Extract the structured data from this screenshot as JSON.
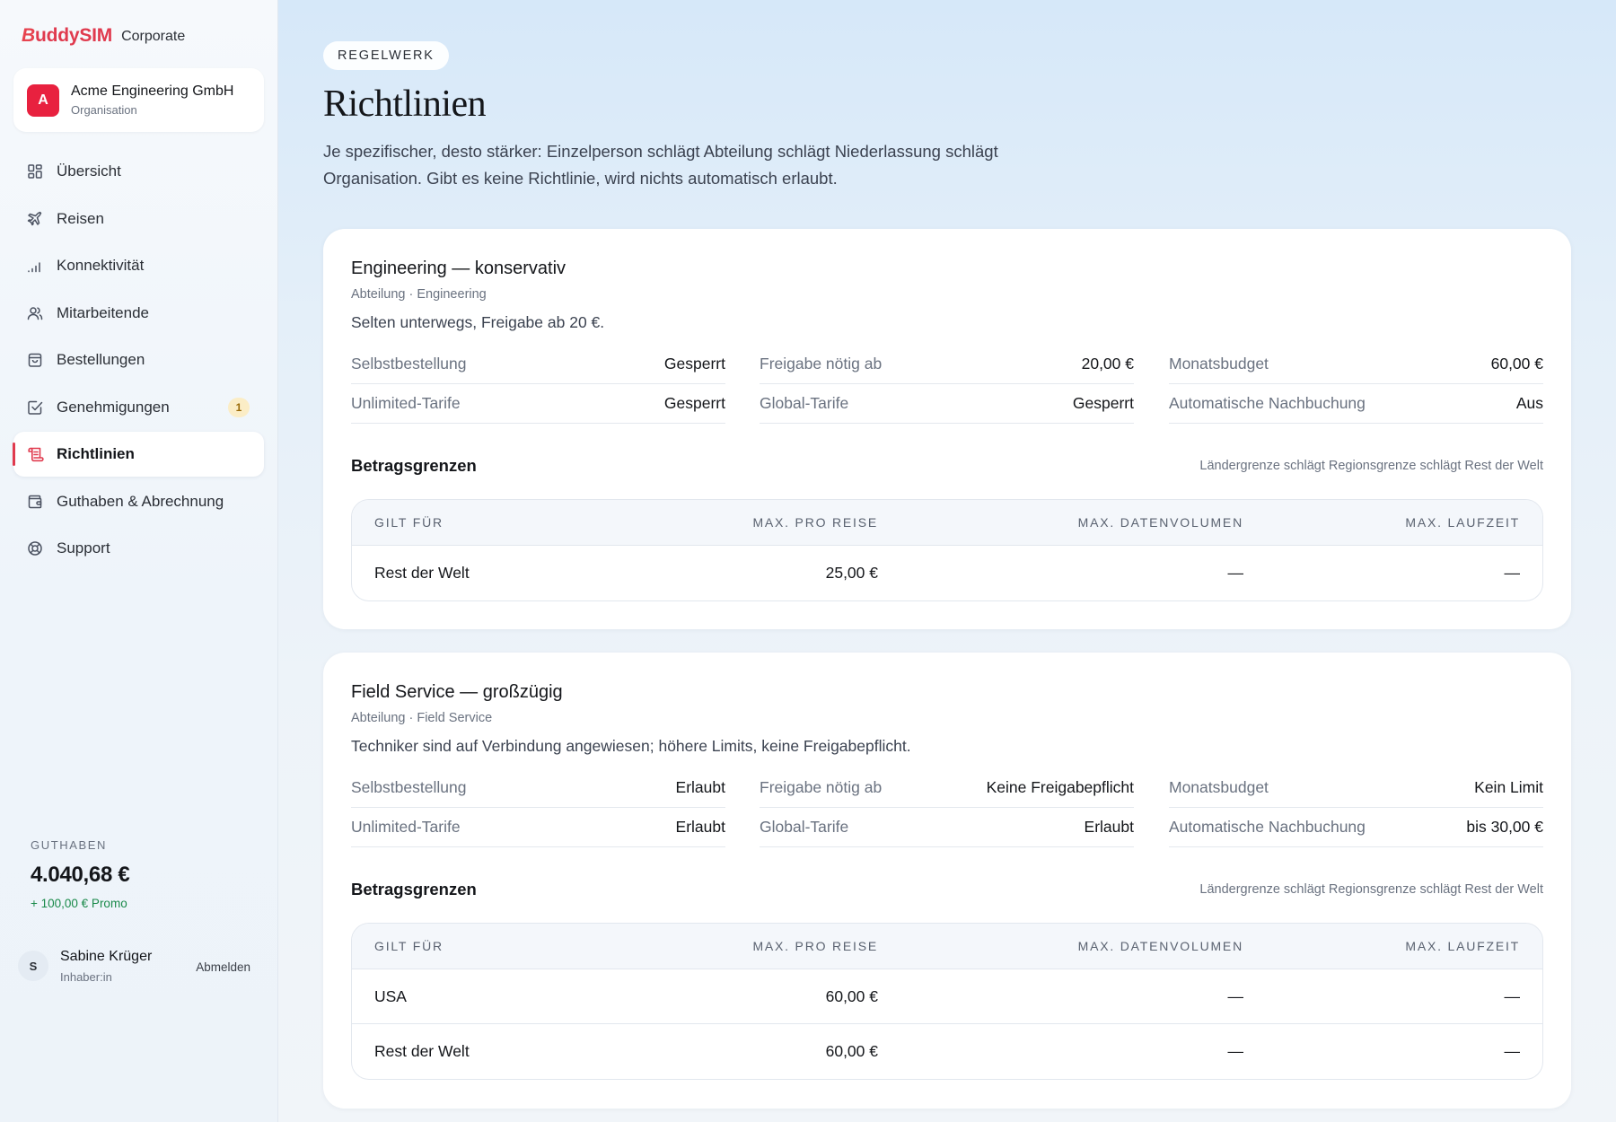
{
  "brand": {
    "logo_b": "B",
    "logo_rest": "uddySIM",
    "product": "Corporate"
  },
  "org": {
    "initial": "A",
    "name": "Acme Engineering GmbH",
    "role": "Organisation"
  },
  "nav": [
    {
      "label": "Übersicht",
      "icon": "grid-icon"
    },
    {
      "label": "Reisen",
      "icon": "plane-icon"
    },
    {
      "label": "Konnektivität",
      "icon": "signal-icon"
    },
    {
      "label": "Mitarbeitende",
      "icon": "users-icon"
    },
    {
      "label": "Bestellungen",
      "icon": "bag-icon"
    },
    {
      "label": "Genehmigungen",
      "icon": "checkbox-icon",
      "badge": "1"
    },
    {
      "label": "Richtlinien",
      "icon": "scroll-icon",
      "active": true
    },
    {
      "label": "Guthaben & Abrechnung",
      "icon": "wallet-icon"
    },
    {
      "label": "Support",
      "icon": "lifebuoy-icon"
    }
  ],
  "credit": {
    "label": "GUTHABEN",
    "amount": "4.040,68 €",
    "promo": "+ 100,00 € Promo"
  },
  "user": {
    "initial": "S",
    "name": "Sabine Krüger",
    "role": "Inhaber:in",
    "logout": "Abmelden"
  },
  "page": {
    "kicker": "REGELWERK",
    "title": "Richtlinien",
    "description": "Je spezifischer, desto stärker: Einzelperson schlägt Abteilung schlägt Niederlassung schlägt Organisation. Gibt es keine Richtlinie, wird nichts automatisch erlaubt."
  },
  "policies": [
    {
      "title": "Engineering — konservativ",
      "scope": "Abteilung · Engineering",
      "description": "Selten unterwegs, Freigabe ab 20 €.",
      "settings": [
        {
          "key": "Selbstbestellung",
          "value": "Gesperrt"
        },
        {
          "key": "Freigabe nötig ab",
          "value": "20,00 €"
        },
        {
          "key": "Monatsbudget",
          "value": "60,00 €"
        },
        {
          "key": "Unlimited-Tarife",
          "value": "Gesperrt"
        },
        {
          "key": "Global-Tarife",
          "value": "Gesperrt"
        },
        {
          "key": "Automatische Nachbuchung",
          "value": "Aus"
        }
      ],
      "limits_title": "Betragsgrenzen",
      "limits_note": "Ländergrenze schlägt Regionsgrenze schlägt Rest der Welt",
      "columns": [
        "GILT FÜR",
        "MAX. PRO REISE",
        "MAX. DATENVOLUMEN",
        "MAX. LAUFZEIT"
      ],
      "rows": [
        [
          "Rest der Welt",
          "25,00 €",
          "—",
          "—"
        ]
      ]
    },
    {
      "title": "Field Service — großzügig",
      "scope": "Abteilung · Field Service",
      "description": "Techniker sind auf Verbindung angewiesen; höhere Limits, keine Freigabepflicht.",
      "settings": [
        {
          "key": "Selbstbestellung",
          "value": "Erlaubt"
        },
        {
          "key": "Freigabe nötig ab",
          "value": "Keine Freigabepflicht"
        },
        {
          "key": "Monatsbudget",
          "value": "Kein Limit"
        },
        {
          "key": "Unlimited-Tarife",
          "value": "Erlaubt"
        },
        {
          "key": "Global-Tarife",
          "value": "Erlaubt"
        },
        {
          "key": "Automatische Nachbuchung",
          "value": "bis 30,00 €"
        }
      ],
      "limits_title": "Betragsgrenzen",
      "limits_note": "Ländergrenze schlägt Regionsgrenze schlägt Rest der Welt",
      "columns": [
        "GILT FÜR",
        "MAX. PRO REISE",
        "MAX. DATENVOLUMEN",
        "MAX. LAUFZEIT"
      ],
      "rows": [
        [
          "USA",
          "60,00 €",
          "—",
          "—"
        ],
        [
          "Rest der Welt",
          "60,00 €",
          "—",
          "—"
        ]
      ]
    }
  ],
  "colors": {
    "accent": "#e03a4e",
    "promo": "#1a8a4a",
    "badge_bg": "#fbedc6"
  }
}
